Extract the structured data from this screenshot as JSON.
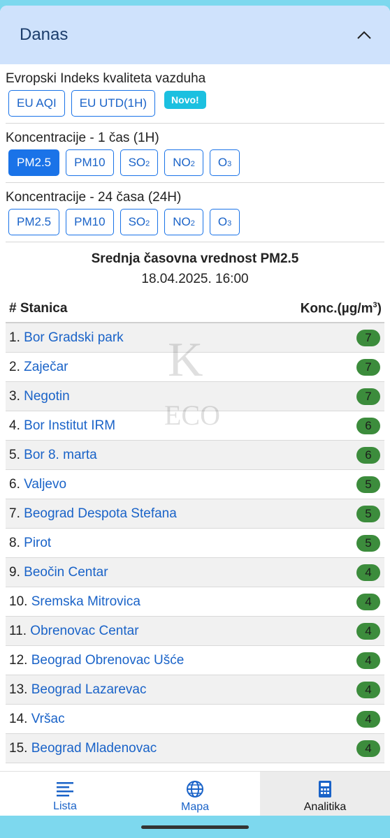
{
  "header": {
    "title": "Danas"
  },
  "eu_section": {
    "label": "Evropski Indeks kvaliteta vazduha",
    "buttons": [
      "EU AQI",
      "EU UTD(1H)"
    ],
    "new_badge": "Novo!"
  },
  "conc_1h": {
    "label": "Koncentracije - 1 čas (1H)",
    "active": "PM2.5"
  },
  "conc_24h": {
    "label": "Koncentracije - 24 časa (24H)"
  },
  "pollutants": {
    "pm25": "PM2.5",
    "pm10": "PM10",
    "so2_base": "SO",
    "so2_sub": "2",
    "no2_base": "NO",
    "no2_sub": "2",
    "o3_base": "O",
    "o3_sub": "3"
  },
  "summary": {
    "title": "Srednja časovna vrednost PM2.5",
    "date": "18.04.2025. 16:00"
  },
  "table": {
    "col_station": "# Stanica",
    "col_conc": "Konc.(µg/m",
    "col_conc_sup": "3",
    "col_conc_end": ")",
    "rows": [
      {
        "num": "1.",
        "name": "Bor Gradski park",
        "value": "7"
      },
      {
        "num": "2.",
        "name": "Zaječar",
        "value": "7"
      },
      {
        "num": "3.",
        "name": "Negotin",
        "value": "7"
      },
      {
        "num": "4.",
        "name": "Bor Institut IRM",
        "value": "6"
      },
      {
        "num": "5.",
        "name": "Bor 8. marta",
        "value": "6"
      },
      {
        "num": "6.",
        "name": "Valjevo",
        "value": "5"
      },
      {
        "num": "7.",
        "name": "Beograd Despota Stefana",
        "value": "5"
      },
      {
        "num": "8.",
        "name": "Pirot",
        "value": "5"
      },
      {
        "num": "9.",
        "name": "Beočin Centar",
        "value": "4"
      },
      {
        "num": "10.",
        "name": "Sremska Mitrovica",
        "value": "4"
      },
      {
        "num": "11.",
        "name": "Obrenovac Centar",
        "value": "4"
      },
      {
        "num": "12.",
        "name": "Beograd Obrenovac Ušće",
        "value": "4"
      },
      {
        "num": "13.",
        "name": "Beograd Lazarevac",
        "value": "4"
      },
      {
        "num": "14.",
        "name": "Vršac",
        "value": "4"
      },
      {
        "num": "15.",
        "name": "Beograd Mladenovac",
        "value": "4"
      }
    ]
  },
  "nav": {
    "items": [
      {
        "label": "Lista",
        "icon": "list-icon"
      },
      {
        "label": "Mapa",
        "icon": "globe-icon"
      },
      {
        "label": "Analitika",
        "icon": "calculator-icon"
      }
    ],
    "active": "Analitika"
  },
  "colors": {
    "accent": "#1a73e8",
    "header_bg": "#cfe2fc",
    "badge_green": "#3c8c3c",
    "new_badge": "#1cc0e0"
  }
}
